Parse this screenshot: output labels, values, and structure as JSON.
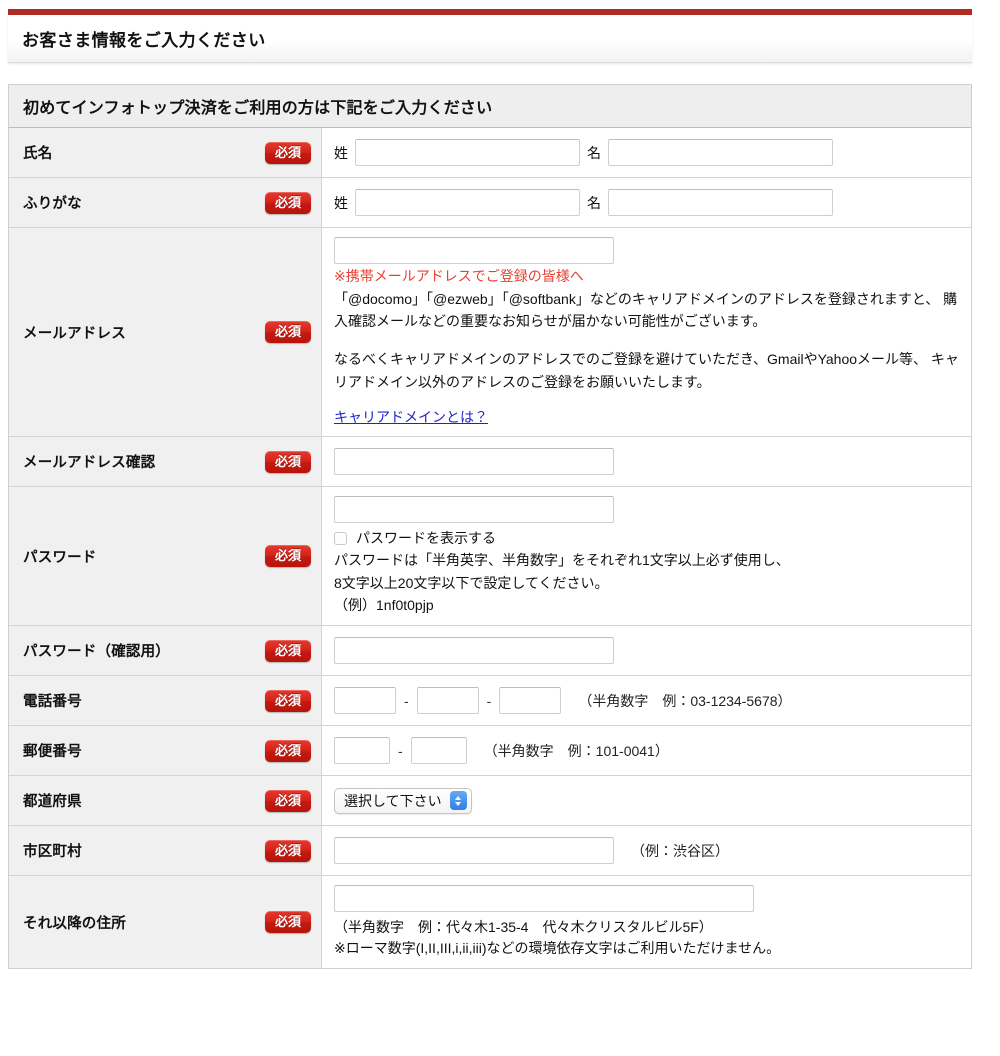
{
  "page": {
    "heading": "お客さま情報をご入力ください",
    "section_header": "初めてインフォトップ決済をご利用の方は下記をご入力ください",
    "required_badge": "必須",
    "accent_color": "#b02b23",
    "badge_color": "#d4231a",
    "link_color": "#2222cc",
    "warning_color": "#e8412f"
  },
  "fields": {
    "name": {
      "label": "氏名",
      "sei_label": "姓",
      "mei_label": "名",
      "sei_value": "",
      "mei_value": ""
    },
    "furigana": {
      "label": "ふりがな",
      "sei_label": "姓",
      "mei_label": "名",
      "sei_value": "",
      "mei_value": ""
    },
    "email": {
      "label": "メールアドレス",
      "value": "",
      "warn_title": "※携帯メールアドレスでご登録の皆様へ",
      "body_1": "「@docomo」「@ezweb」「@softbank」などのキャリアドメインのアドレスを登録されますと、 購入確認メールなどの重要なお知らせが届かない可能性がございます。",
      "body_2": "なるべくキャリアドメインのアドレスでのご登録を避けていただき、GmailやYahooメール等、 キャリアドメイン以外のアドレスのご登録をお願いいたします。",
      "link_text": "キャリアドメインとは？"
    },
    "email_confirm": {
      "label": "メールアドレス確認",
      "value": ""
    },
    "password": {
      "label": "パスワード",
      "value": "",
      "show_password_label": "パスワードを表示する",
      "show_password_checked": false,
      "rule_line_1": "パスワードは「半角英字、半角数字」をそれぞれ1文字以上必ず使用し、",
      "rule_line_2": "8文字以上20文字以下で設定してください。",
      "example_line": "（例）1nf0t0pjp"
    },
    "password_confirm": {
      "label": "パスワード（確認用）",
      "value": ""
    },
    "tel": {
      "label": "電話番号",
      "part1": "",
      "part2": "",
      "part3": "",
      "separator": "-",
      "hint": "（半角数字　例：03-1234-5678）"
    },
    "zip": {
      "label": "郵便番号",
      "part1": "",
      "part2": "",
      "separator": "-",
      "hint": "（半角数字　例：101-0041）"
    },
    "prefecture": {
      "label": "都道府県",
      "selected": "選択して下さい"
    },
    "city": {
      "label": "市区町村",
      "value": "",
      "hint": "（例：渋谷区）"
    },
    "address": {
      "label": "それ以降の住所",
      "value": "",
      "hint_1": "（半角数字　例：代々木1-35-4　代々木クリスタルビル5F）",
      "hint_2": "※ローマ数字(I,II,III,i,ii,iii)などの環境依存文字はご利用いただけません。"
    }
  }
}
